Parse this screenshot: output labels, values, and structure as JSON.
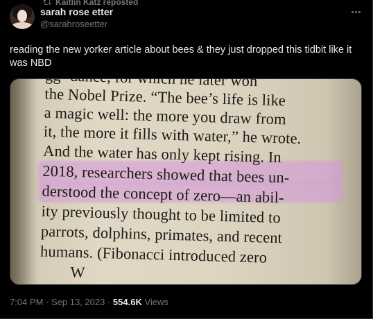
{
  "repost": {
    "text": "Kaitlin Katz reposted"
  },
  "author": {
    "display_name": "sarah rose etter",
    "handle": "@sarahroseetter"
  },
  "tweet": {
    "text": "reading the new yorker article about bees & they just dropped this tidbit like it was NBD"
  },
  "media": {
    "book_lines": [
      "gg- dance, for which he later won",
      "the Nobel Prize. “The bee’s life is like",
      "a magic well: the more you draw from",
      "it, the more it fills with water,” he wrote.",
      "And the water has only kept rising. In",
      "2018, researchers showed that bees un-",
      "derstood the concept of zero—an abil-",
      "ity previously thought to be limited to",
      "parrots, dolphins, primates, and recent",
      "humans. (Fibonacci introduced zero",
      "W"
    ]
  },
  "meta": {
    "time": "7:04 PM",
    "sep1": " · ",
    "date": "Sep 13, 2023",
    "sep2": " · ",
    "views_count": "554.6K",
    "views_label": " Views"
  },
  "colors": {
    "background": "#000000",
    "text_primary": "#e7e9ea",
    "text_secondary": "#71767b",
    "highlight": "#d496dc"
  }
}
